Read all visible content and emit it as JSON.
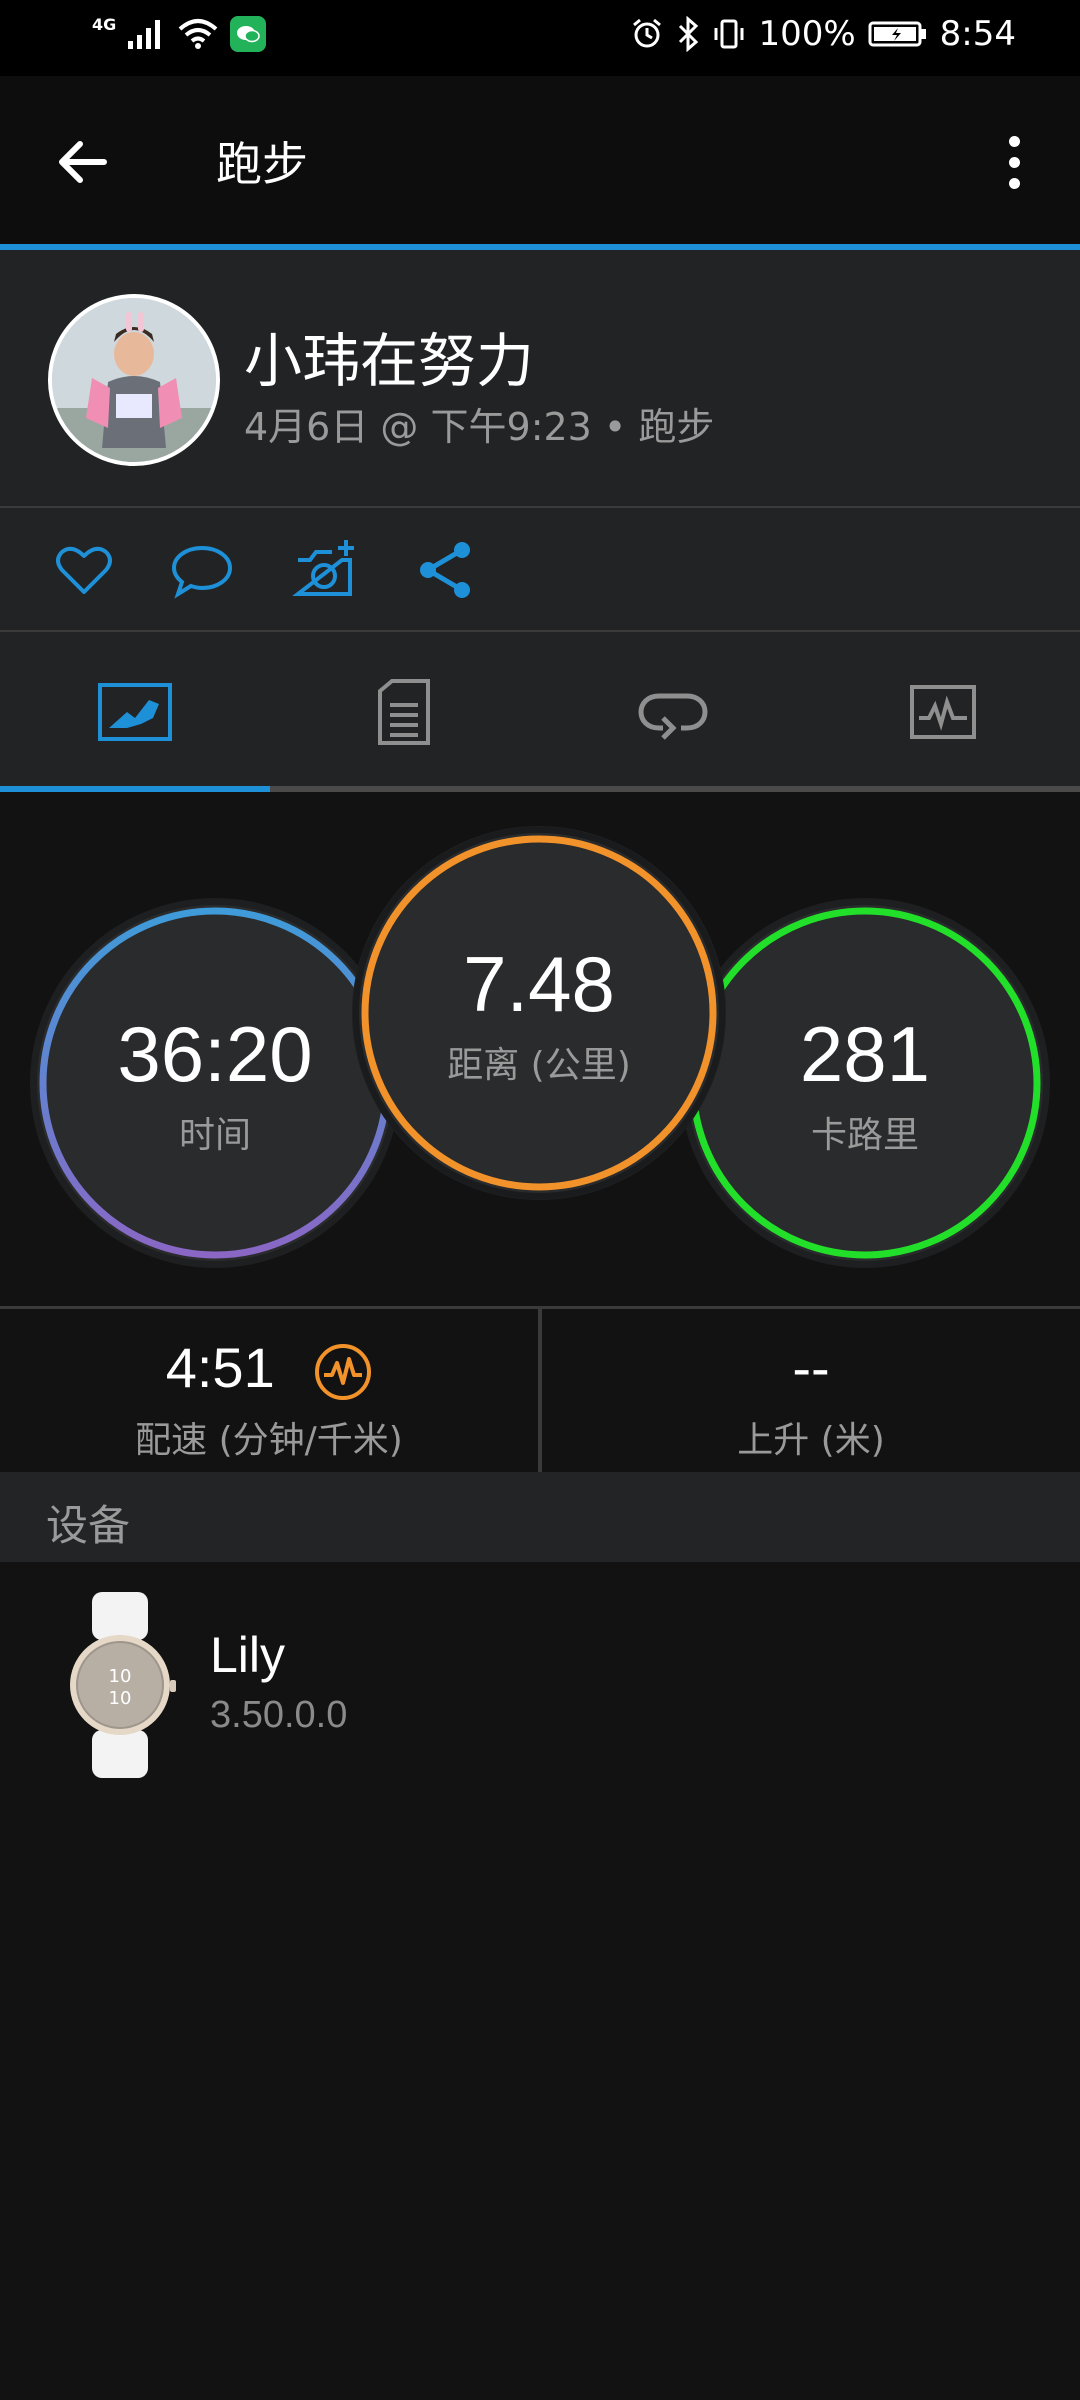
{
  "status_bar": {
    "network": "4G",
    "battery": "100%",
    "time": "8:54",
    "icons": [
      "signal-icon",
      "wifi-icon",
      "wechat-icon",
      "alarm-icon",
      "bluetooth-icon",
      "vibrate-icon",
      "battery-icon"
    ]
  },
  "app_bar": {
    "title": "跑步",
    "back_icon": "back-arrow-icon",
    "more_icon": "more-vertical-icon"
  },
  "profile": {
    "name": "小玮在努力",
    "meta": "4月6日 @ 下午9:23 • 跑步"
  },
  "actions": [
    "like-icon",
    "comment-icon",
    "add-photo-icon",
    "share-icon"
  ],
  "tabs": {
    "items": [
      "overview-tab",
      "details-tab",
      "laps-tab",
      "charts-tab"
    ],
    "active_index": 0
  },
  "stats": {
    "time": {
      "value": "36:20",
      "label": "时间"
    },
    "distance": {
      "value": "7.48",
      "label": "距离 (公里)"
    },
    "calories": {
      "value": "281",
      "label": "卡路里"
    }
  },
  "metrics": {
    "pace": {
      "value": "4:51",
      "label": "配速 (分钟/千米)"
    },
    "elevation": {
      "value": "--",
      "label": "上升 (米)"
    }
  },
  "devices_section": {
    "title": "设备",
    "device_name": "Lily",
    "device_version": "3.50.0.0"
  },
  "colors": {
    "accent": "#1e90d8",
    "time_ring": "#5a8fd8",
    "distance_ring": "#f2922b",
    "calories_ring": "#22e02a",
    "pace_icon": "#f2922b"
  }
}
